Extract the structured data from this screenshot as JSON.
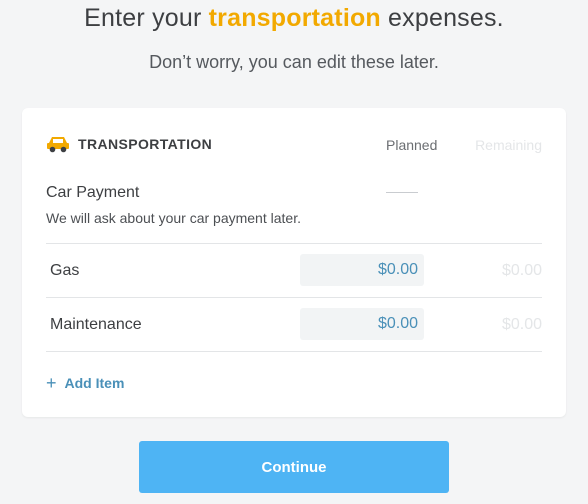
{
  "header": {
    "title_before": "Enter your ",
    "title_accent": "transportation",
    "title_after": " expenses.",
    "subtitle": "Don’t worry, you can edit these later."
  },
  "colors": {
    "accent": "#f2a900",
    "link": "#4a90b8",
    "button": "#4eb4f4"
  },
  "card": {
    "icon": "car-icon",
    "group_title": "TRANSPORTATION",
    "col_planned": "Planned",
    "col_remaining": "Remaining",
    "car_payment": {
      "name": "Car Payment",
      "note": "We will ask about your car payment later."
    },
    "items": [
      {
        "label": "Gas",
        "planned": "$0.00",
        "remaining": "$0.00"
      },
      {
        "label": "Maintenance",
        "planned": "$0.00",
        "remaining": "$0.00"
      }
    ],
    "add_item": "Add Item"
  },
  "footer": {
    "continue_label": "Continue"
  }
}
